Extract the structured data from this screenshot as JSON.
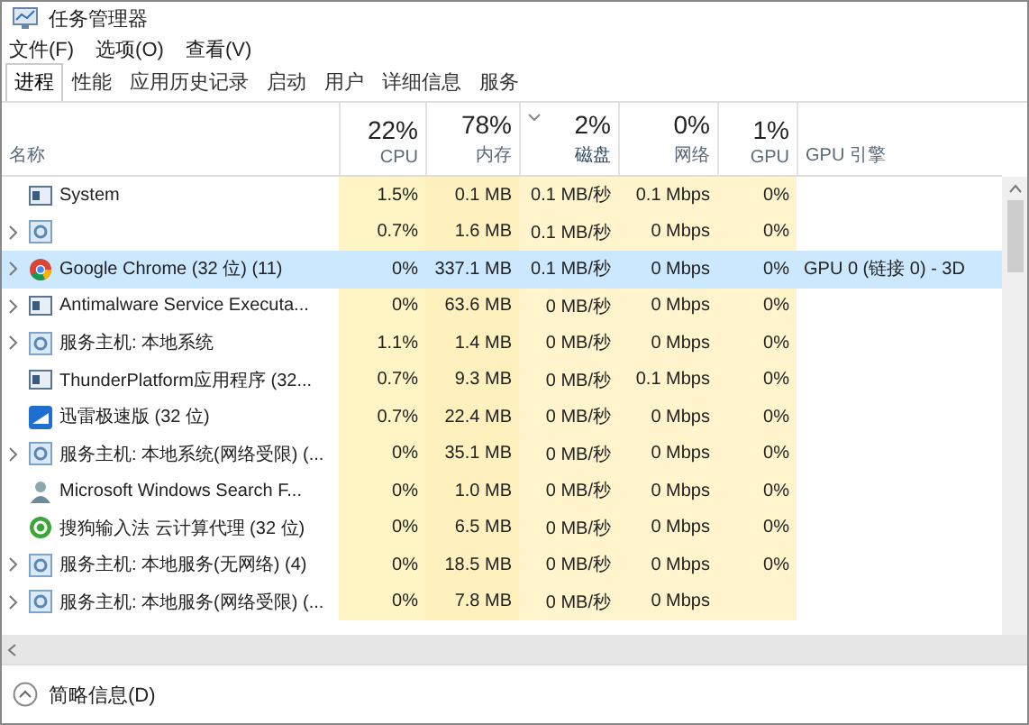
{
  "window": {
    "title": "任务管理器"
  },
  "menu": [
    "文件(F)",
    "选项(O)",
    "查看(V)"
  ],
  "tabs": [
    {
      "label": "进程",
      "selected": true
    },
    {
      "label": "性能",
      "selected": false
    },
    {
      "label": "应用历史记录",
      "selected": false
    },
    {
      "label": "启动",
      "selected": false
    },
    {
      "label": "用户",
      "selected": false
    },
    {
      "label": "详细信息",
      "selected": false
    },
    {
      "label": "服务",
      "selected": false
    }
  ],
  "table": {
    "columns": [
      {
        "label": "名称",
        "sorted": false
      },
      {
        "percent": "22%",
        "label": "CPU",
        "sorted": false
      },
      {
        "percent": "78%",
        "label": "内存",
        "sorted": false
      },
      {
        "percent": "2%",
        "label": "磁盘",
        "sorted": true
      },
      {
        "percent": "0%",
        "label": "网络",
        "sorted": false
      },
      {
        "percent": "1%",
        "label": "GPU",
        "sorted": false
      },
      {
        "label": "GPU 引擎",
        "sorted": false
      }
    ],
    "rows": [
      {
        "kind": "window",
        "expandable": false,
        "selected": false,
        "cells": [
          "System",
          "1.5%",
          "0.1 MB",
          "0.1 MB/秒",
          "0.1 Mbps",
          "0%"
        ]
      },
      {
        "kind": "gear",
        "expandable": true,
        "selected": false,
        "cells": [
          "",
          "0.7%",
          "1.6 MB",
          "0.1 MB/秒",
          "0 Mbps",
          "0%"
        ]
      },
      {
        "kind": "chrome",
        "expandable": true,
        "selected": true,
        "cells": [
          "Google Chrome (32 位) (11)",
          "0%",
          "337.1 MB",
          "0.1 MB/秒",
          "0 Mbps",
          "0%",
          "GPU 0 (链接 0) - 3D"
        ]
      },
      {
        "kind": "window",
        "expandable": true,
        "selected": false,
        "cells": [
          "Antimalware Service Executa...",
          "0%",
          "63.6 MB",
          "0 MB/秒",
          "0 Mbps",
          "0%"
        ]
      },
      {
        "kind": "gear",
        "expandable": true,
        "selected": false,
        "cells": [
          "服务主机: 本地系统",
          "1.1%",
          "1.4 MB",
          "0 MB/秒",
          "0 Mbps",
          "0%"
        ]
      },
      {
        "kind": "window",
        "expandable": false,
        "selected": false,
        "cells": [
          "ThunderPlatform应用程序 (32...",
          "0.7%",
          "9.3 MB",
          "0 MB/秒",
          "0.1 Mbps",
          "0%"
        ]
      },
      {
        "kind": "tile",
        "expandable": false,
        "selected": false,
        "cells": [
          "迅雷极速版 (32 位)",
          "0.7%",
          "22.4 MB",
          "0 MB/秒",
          "0 Mbps",
          "0%"
        ]
      },
      {
        "kind": "gear",
        "expandable": true,
        "selected": false,
        "cells": [
          "服务主机: 本地系统(网络受限) (...",
          "0%",
          "35.1 MB",
          "0 MB/秒",
          "0 Mbps",
          "0%"
        ]
      },
      {
        "kind": "user",
        "expandable": false,
        "selected": false,
        "cells": [
          "Microsoft Windows Search F...",
          "0%",
          "1.0 MB",
          "0 MB/秒",
          "0 Mbps",
          "0%"
        ]
      },
      {
        "kind": "circle",
        "expandable": false,
        "selected": false,
        "cells": [
          "搜狗输入法 云计算代理 (32 位)",
          "0%",
          "6.5 MB",
          "0 MB/秒",
          "0 Mbps",
          "0%"
        ]
      },
      {
        "kind": "gear",
        "expandable": true,
        "selected": false,
        "cells": [
          "服务主机: 本地服务(无网络) (4)",
          "0%",
          "18.5 MB",
          "0 MB/秒",
          "0 Mbps",
          "0%"
        ]
      },
      {
        "kind": "gear",
        "expandable": true,
        "selected": false,
        "cells": [
          "服务主机: 本地服务(网络受限) (...",
          "0%",
          "7.8 MB",
          "0 MB/秒",
          "0 Mbps"
        ]
      }
    ]
  },
  "footer": {
    "label": "简略信息(D)"
  }
}
